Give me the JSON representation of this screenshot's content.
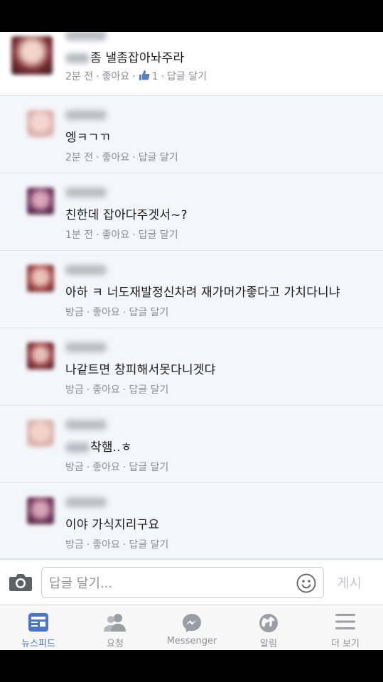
{
  "comments": [
    {
      "text": "좀 낼좀잡아놔주라",
      "time": "2분 전",
      "like": "좋아요",
      "like_count": "1",
      "reply": "답글 달기"
    },
    {
      "text": "엥ㅋㄱㄲ",
      "time": "2분 전",
      "like": "좋아요",
      "reply": "답글 달기"
    },
    {
      "text": "친한데 잡아다주겟서~?",
      "time": "1분 전",
      "like": "좋아요",
      "reply": "답글 달기"
    },
    {
      "text": "아하 ㅋ 너도재발정신차려 재가머가좋다고 가치다니냐",
      "time": "방금",
      "like": "좋아요",
      "reply": "답글 달기"
    },
    {
      "text": "나같트면 창피해서못다니겟댜",
      "time": "방금",
      "like": "좋아요",
      "reply": "답글 달기"
    },
    {
      "text": "착햄..ㅎ",
      "time": "방금",
      "like": "좋아요",
      "reply": "답글 달기"
    },
    {
      "text": "이야 가식지리구요",
      "time": "방금",
      "like": "좋아요",
      "reply": "답글 달기"
    }
  ],
  "input": {
    "placeholder": "답글 달기...",
    "post": "게시"
  },
  "tabs": [
    {
      "label": "뉴스피드",
      "icon": "news-feed-icon",
      "active": true
    },
    {
      "label": "요청",
      "icon": "friend-requests-icon"
    },
    {
      "label": "Messenger",
      "icon": "messenger-icon"
    },
    {
      "label": "알림",
      "icon": "globe-notifications-icon"
    },
    {
      "label": "더 보기",
      "icon": "menu-icon"
    }
  ],
  "colors": {
    "accent": "#4a76c8",
    "meta": "#8a8d91",
    "reply_bg": "#f4f6f9"
  }
}
